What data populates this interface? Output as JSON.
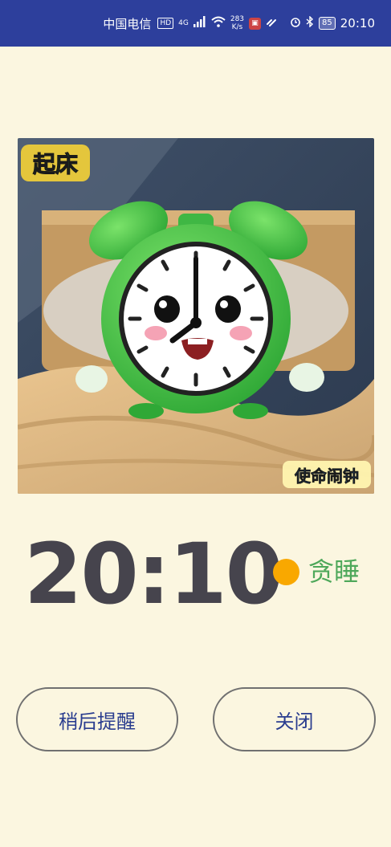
{
  "status_bar": {
    "carrier": "中国电信",
    "hd_badge": "HD",
    "network": "4G",
    "speed_value": "283",
    "speed_unit": "K/s",
    "battery": "85",
    "time": "20:10"
  },
  "hero_image": {
    "sticker_top_left": "起床",
    "sticker_bottom_right": "使命闹钟"
  },
  "alarm": {
    "time": "20:10",
    "mode_label": "贪睡",
    "mode_color": "#f9a800"
  },
  "actions": {
    "snooze_label": "稍后提醒",
    "close_label": "关闭"
  },
  "colors": {
    "status_bar_bg": "#2d3f9c",
    "page_bg": "#fbf6e0",
    "time_text": "#46444d",
    "mode_text": "#4ea85a",
    "button_text": "#2a3d8f"
  }
}
